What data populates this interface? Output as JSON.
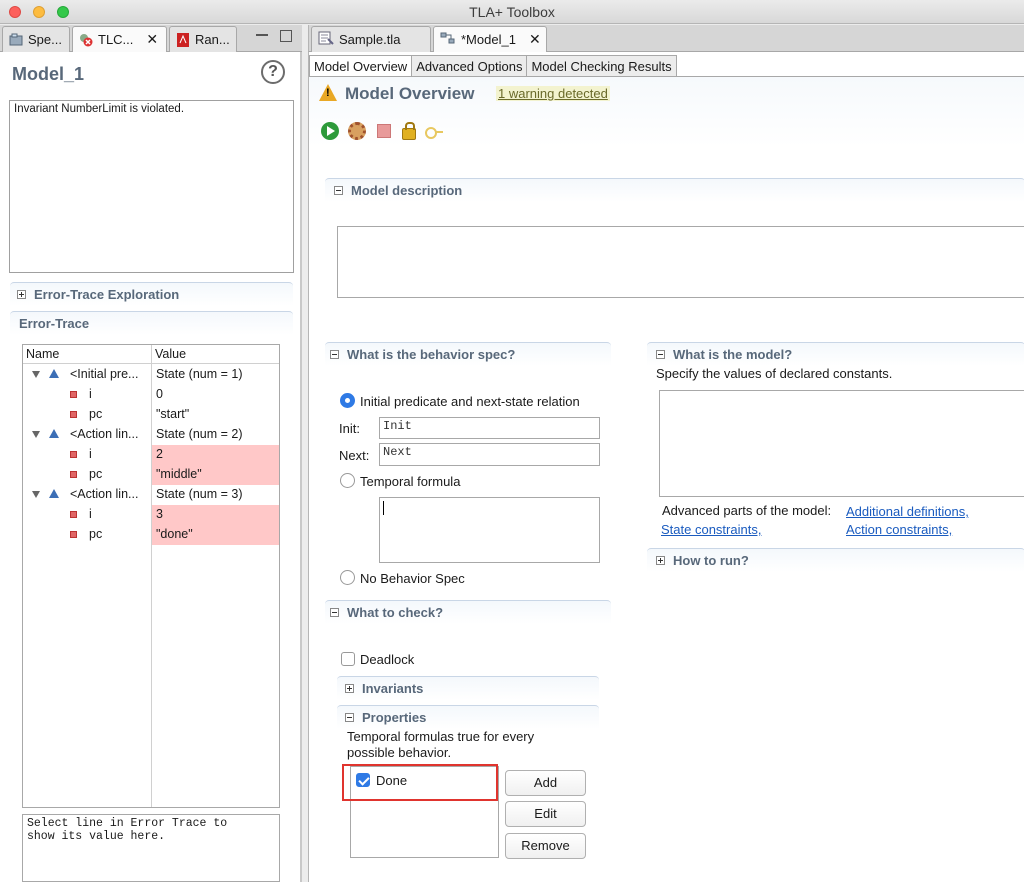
{
  "window": {
    "title": "TLA+ Toolbox"
  },
  "left_tabs": [
    {
      "label": "Spe...",
      "icon": "spec-explorer-icon"
    },
    {
      "label": "TLC...",
      "icon": "tlc-error-icon"
    },
    {
      "label": "Ran...",
      "icon": "pdf-icon"
    }
  ],
  "left_panel": {
    "title": "Model_1",
    "message": "Invariant NumberLimit is violated.",
    "exploration_header": "Error-Trace Exploration",
    "trace_header": "Error-Trace",
    "columns": {
      "name": "Name",
      "value": "Value"
    },
    "rows": [
      {
        "name": "<Initial pre...",
        "value": "State (num = 1)"
      },
      {
        "name": "i",
        "value": "0"
      },
      {
        "name": "pc",
        "value": "\"start\""
      },
      {
        "name": "<Action lin...",
        "value": "State (num = 2)"
      },
      {
        "name": "i",
        "value": "2"
      },
      {
        "name": "pc",
        "value": "\"middle\""
      },
      {
        "name": "<Action lin...",
        "value": "State (num = 3)"
      },
      {
        "name": "i",
        "value": "3"
      },
      {
        "name": "pc",
        "value": "\"done\""
      }
    ],
    "value_hint": "Select line in Error Trace to\nshow its value here."
  },
  "editor_tabs": [
    {
      "label": "Sample.tla",
      "icon": "tla-file-icon"
    },
    {
      "label": "*Model_1",
      "icon": "model-icon"
    }
  ],
  "page_tabs": [
    "Model Overview",
    "Advanced Options",
    "Model Checking Results"
  ],
  "overview": {
    "title": "Model Overview",
    "warning": "1 warning detected",
    "model_description": {
      "header": "Model description"
    },
    "behavior": {
      "header": "What is the behavior spec?",
      "option_init_next": "Initial predicate and next-state relation",
      "init_label": "Init:",
      "init_value": "Init",
      "next_label": "Next:",
      "next_value": "Next",
      "option_temporal": "Temporal formula",
      "option_none": "No Behavior Spec",
      "selected": "option_init_next"
    },
    "check": {
      "header": "What to check?",
      "deadlock_label": "Deadlock",
      "deadlock_checked": false,
      "invariants_header": "Invariants",
      "properties_header": "Properties",
      "properties_desc_1": "Temporal formulas true for every",
      "properties_desc_2": "possible behavior.",
      "properties": [
        {
          "label": "Done",
          "checked": true
        }
      ],
      "add": "Add",
      "edit": "Edit",
      "remove": "Remove"
    },
    "model": {
      "header": "What is the model?",
      "desc": "Specify the values of declared constants.",
      "advanced_label": "Advanced parts of the model:",
      "link_additional": "Additional definitions,",
      "link_state": "State constraints,",
      "link_action": "Action constraints,"
    },
    "how_to_run": {
      "header": "How to run?"
    }
  },
  "colors": {
    "changed_value_bg": "#ffc8c8",
    "header_text": "#58687a",
    "highlight": "#e0342e",
    "accent": "#2f7ae5"
  }
}
